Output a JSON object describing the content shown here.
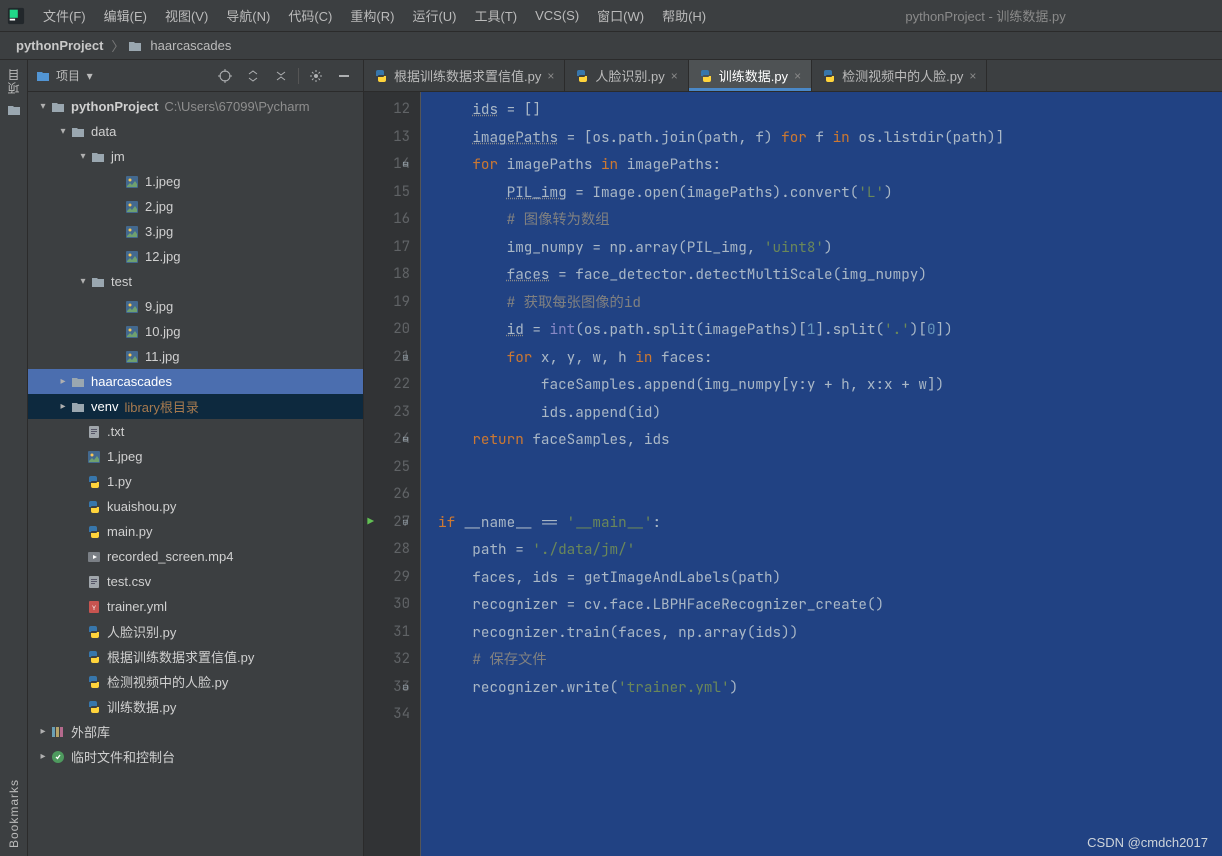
{
  "menubar": {
    "items": [
      "文件(F)",
      "编辑(E)",
      "视图(V)",
      "导航(N)",
      "代码(C)",
      "重构(R)",
      "运行(U)",
      "工具(T)",
      "VCS(S)",
      "窗口(W)",
      "帮助(H)"
    ],
    "window_title": "pythonProject - 训练数据.py"
  },
  "breadcrumb": {
    "project": "pythonProject",
    "folder": "haarcascades"
  },
  "sidebar": {
    "proj_label": "项目",
    "bookmarks_label": "Bookmarks"
  },
  "project": {
    "header_label": "项目",
    "root": {
      "name": "pythonProject",
      "path": "C:\\Users\\67099\\Pycharm"
    },
    "data_folder": "data",
    "jm_folder": "jm",
    "jm_files": [
      "1.jpeg",
      "2.jpg",
      "3.jpg",
      "12.jpg"
    ],
    "test_folder": "test",
    "test_files": [
      "9.jpg",
      "10.jpg",
      "11.jpg"
    ],
    "haarcascades": "haarcascades",
    "venv": "venv",
    "venv_note": "library根目录",
    "root_files": [
      ".txt",
      "1.jpeg",
      "1.py",
      "kuaishou.py",
      "main.py",
      "recorded_screen.mp4",
      "test.csv",
      "trainer.yml",
      "人脸识别.py",
      "根据训练数据求置信值.py",
      "检测视频中的人脸.py",
      "训练数据.py"
    ],
    "ext_lib": "外部库",
    "scratches": "临时文件和控制台"
  },
  "tabs": [
    {
      "label": "根据训练数据求置信值.py",
      "active": false
    },
    {
      "label": "人脸识别.py",
      "active": false
    },
    {
      "label": "训练数据.py",
      "active": true
    },
    {
      "label": "检测视频中的人脸.py",
      "active": false
    }
  ],
  "editor": {
    "first_line": 12,
    "run_marker_line": 27
  },
  "statusbar": {
    "text": "CSDN @cmdch2017"
  }
}
